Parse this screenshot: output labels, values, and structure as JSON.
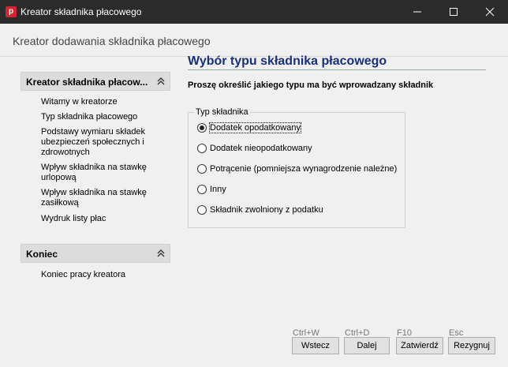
{
  "window": {
    "title": "Kreator składnika płacowego",
    "app_icon_letter": "p"
  },
  "header": {
    "title": "Kreator dodawania składnika płacowego"
  },
  "sidebar": {
    "groups": [
      {
        "title": "Kreator składnika płacow...",
        "items": [
          {
            "label": "Witamy w kreatorze"
          },
          {
            "label": "Typ składnika płacowego"
          },
          {
            "label": "Podstawy wymiaru składek ubezpieczeń społecznych i zdrowotnych"
          },
          {
            "label": "Wpływ składnika na stawkę urlopową"
          },
          {
            "label": "Wpływ składnika na stawkę zasiłkową"
          },
          {
            "label": "Wydruk listy płac"
          }
        ]
      },
      {
        "title": "Koniec",
        "items": [
          {
            "label": "Koniec pracy kreatora"
          }
        ]
      }
    ]
  },
  "main": {
    "section_title": "Wybór typu składnika płacowego",
    "instruction": "Proszę określić jakiego typu ma być wprowadzany składnik",
    "group_label": "Typ składnika",
    "options": [
      {
        "label": "Dodatek opodatkowany",
        "checked": true
      },
      {
        "label": "Dodatek nieopodatkowany",
        "checked": false
      },
      {
        "label": "Potrącenie (pomniejsza wynagrodzenie należne)",
        "checked": false
      },
      {
        "label": "Inny",
        "checked": false
      },
      {
        "label": "Składnik zwolniony z podatku",
        "checked": false
      }
    ]
  },
  "footer": {
    "buttons": [
      {
        "label": "Wstecz",
        "shortcut": "Ctrl+W"
      },
      {
        "label": "Dalej",
        "shortcut": "Ctrl+D"
      },
      {
        "label": "Zatwierdź",
        "shortcut": "F10"
      },
      {
        "label": "Rezygnuj",
        "shortcut": "Esc"
      }
    ]
  },
  "colors": {
    "titlebar_bg": "#2b2b2b",
    "section_title": "#1a2f7a",
    "app_icon": "#d9232e"
  }
}
